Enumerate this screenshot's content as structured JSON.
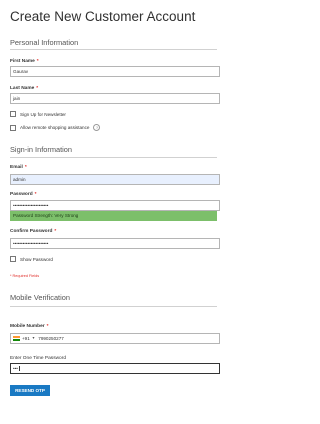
{
  "page_title": "Create New Customer Account",
  "personal": {
    "section_title": "Personal Information",
    "first_name_label": "First Name",
    "first_name_value": "Gaurav",
    "last_name_label": "Last Name",
    "last_name_value": "jain",
    "newsletter_label": "Sign Up for Newsletter",
    "remote_assist_label": "Allow remote shopping assistance",
    "help_icon_glyph": "?"
  },
  "signin": {
    "section_title": "Sign-in Information",
    "email_label": "Email",
    "email_value": "admin",
    "password_label": "Password",
    "password_value": "••••••••••••••••••••••",
    "strength_text": "Password Strength: Very Strong",
    "confirm_label": "Confirm Password",
    "confirm_value": "••••••••••••••••••••••",
    "show_password_label": "Show Password",
    "required_note": "* Required Fields"
  },
  "mobile": {
    "section_title": "Mobile Verification",
    "number_label": "Mobile Number",
    "dial_code": "+91",
    "caret_glyph": "▼",
    "number_value": "7990250277",
    "otp_label": "Enter One Time Password",
    "otp_value": "•••",
    "resend_label": "RESEND OTP"
  },
  "required_mark": "*",
  "colors": {
    "accent": "#1979c3",
    "required": "#e02b27",
    "strength_bar": "#7cbf6a",
    "autofill": "#e8f0fe"
  },
  "icons": [
    "help-icon",
    "india-flag-icon",
    "checkbox-icon"
  ]
}
